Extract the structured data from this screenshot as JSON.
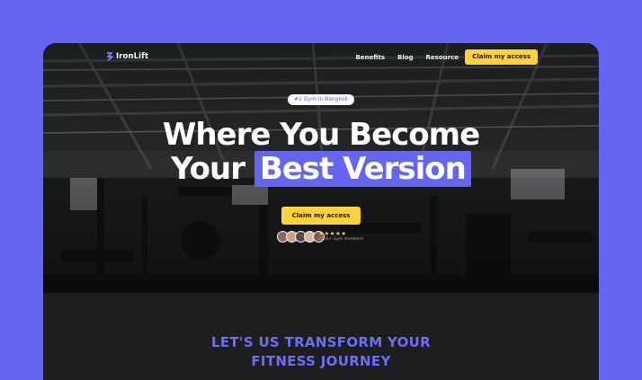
{
  "brand": {
    "name": "IronLift",
    "accent": "#6466f1",
    "cta_color": "#ffd23c"
  },
  "nav": {
    "links": [
      "Benefits",
      "Blog",
      "Resource"
    ],
    "cta_label": "Claim my access"
  },
  "hero": {
    "badge": "#1 Gym in Bangkok",
    "headline_line1": "Where You Become",
    "headline_line2_plain": "Your",
    "headline_line2_highlight": "Best Version",
    "cta_label": "Claim my access",
    "rating_stars": "★★★★★",
    "members_text": "2000+ Gym members",
    "avatar_colors": [
      "#8a6a58",
      "#c9a48a",
      "#5b4a44",
      "#d8b89f",
      "#7b5c4c"
    ]
  },
  "section": {
    "title_line1": "LET'S US TRANSFORM YOUR",
    "title_line2": "FITNESS JOURNEY"
  }
}
